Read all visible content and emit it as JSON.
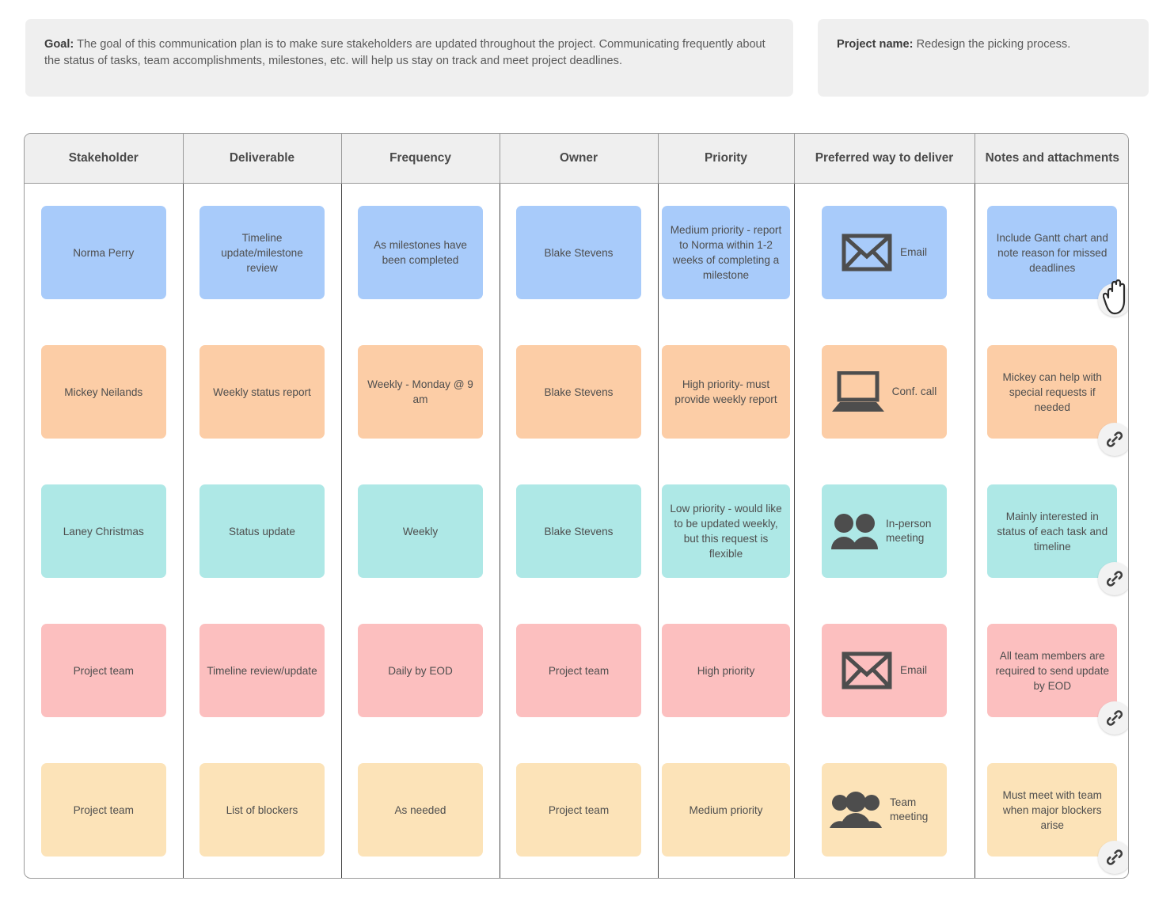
{
  "banners": {
    "goal": {
      "label": "Goal:",
      "text": " The goal of this communication plan is to make sure stakeholders are updated throughout the project. Communicating frequently about the status of tasks, team accomplishments, milestones, etc. will help us stay on track and meet project deadlines."
    },
    "project": {
      "label": "Project name:",
      "text": " Redesign the picking process."
    }
  },
  "table": {
    "headers": [
      "Stakeholder",
      "Deliverable",
      "Frequency",
      "Owner",
      "Priority",
      "Preferred way to deliver",
      "Notes and attachments"
    ],
    "rows": [
      {
        "color": "#a8cbfa",
        "stakeholder": "Norma Perry",
        "deliverable": "Timeline update/milestone review",
        "frequency": "As milestones have been completed",
        "owner": "Blake Stevens",
        "priority": "Medium priority - report to Norma within 1-2 weeks of completing a milestone",
        "deliver_icon": "email-icon",
        "deliver_label": "Email",
        "notes": "Include Gantt chart and note reason for missed deadlines",
        "link_icon": "link-icon"
      },
      {
        "color": "#fccda6",
        "stakeholder": "Mickey Neilands",
        "deliverable": "Weekly status report",
        "frequency": "Weekly - Monday @ 9 am",
        "owner": "Blake Stevens",
        "priority": "High priority- must provide weekly report",
        "deliver_icon": "laptop-icon",
        "deliver_label": "Conf. call",
        "notes": "Mickey can help with special requests if needed",
        "link_icon": "link-icon"
      },
      {
        "color": "#aee8e6",
        "stakeholder": "Laney Christmas",
        "deliverable": "Status update",
        "frequency": "Weekly",
        "owner": "Blake Stevens",
        "priority": "Low priority - would like to be updated weekly, but this request is flexible",
        "deliver_icon": "two-people-icon",
        "deliver_label": "In-person meeting",
        "notes": "Mainly interested in status of each task and timeline",
        "link_icon": "link-icon"
      },
      {
        "color": "#fcbfbf",
        "stakeholder": "Project team",
        "deliverable": "Timeline review/update",
        "frequency": "Daily by EOD",
        "owner": "Project team",
        "priority": "High priority",
        "deliver_icon": "email-icon",
        "deliver_label": "Email",
        "notes": "All team members are required to send update by EOD",
        "link_icon": "link-icon"
      },
      {
        "color": "#fce3b8",
        "stakeholder": "Project team",
        "deliverable": "List of blockers",
        "frequency": "As needed",
        "owner": "Project team",
        "priority": "Medium priority",
        "deliver_icon": "three-people-icon",
        "deliver_label": "Team meeting",
        "notes": "Must meet with team when major blockers arise",
        "link_icon": "link-icon"
      }
    ]
  },
  "cursor": {
    "icon": "pointer-hand-cursor"
  },
  "colors": {
    "banner_bg": "#efefef",
    "header_bg": "#efefef",
    "border": "#9a9a9a",
    "text": "#4e4e4e",
    "icon": "#4d4d4d"
  }
}
